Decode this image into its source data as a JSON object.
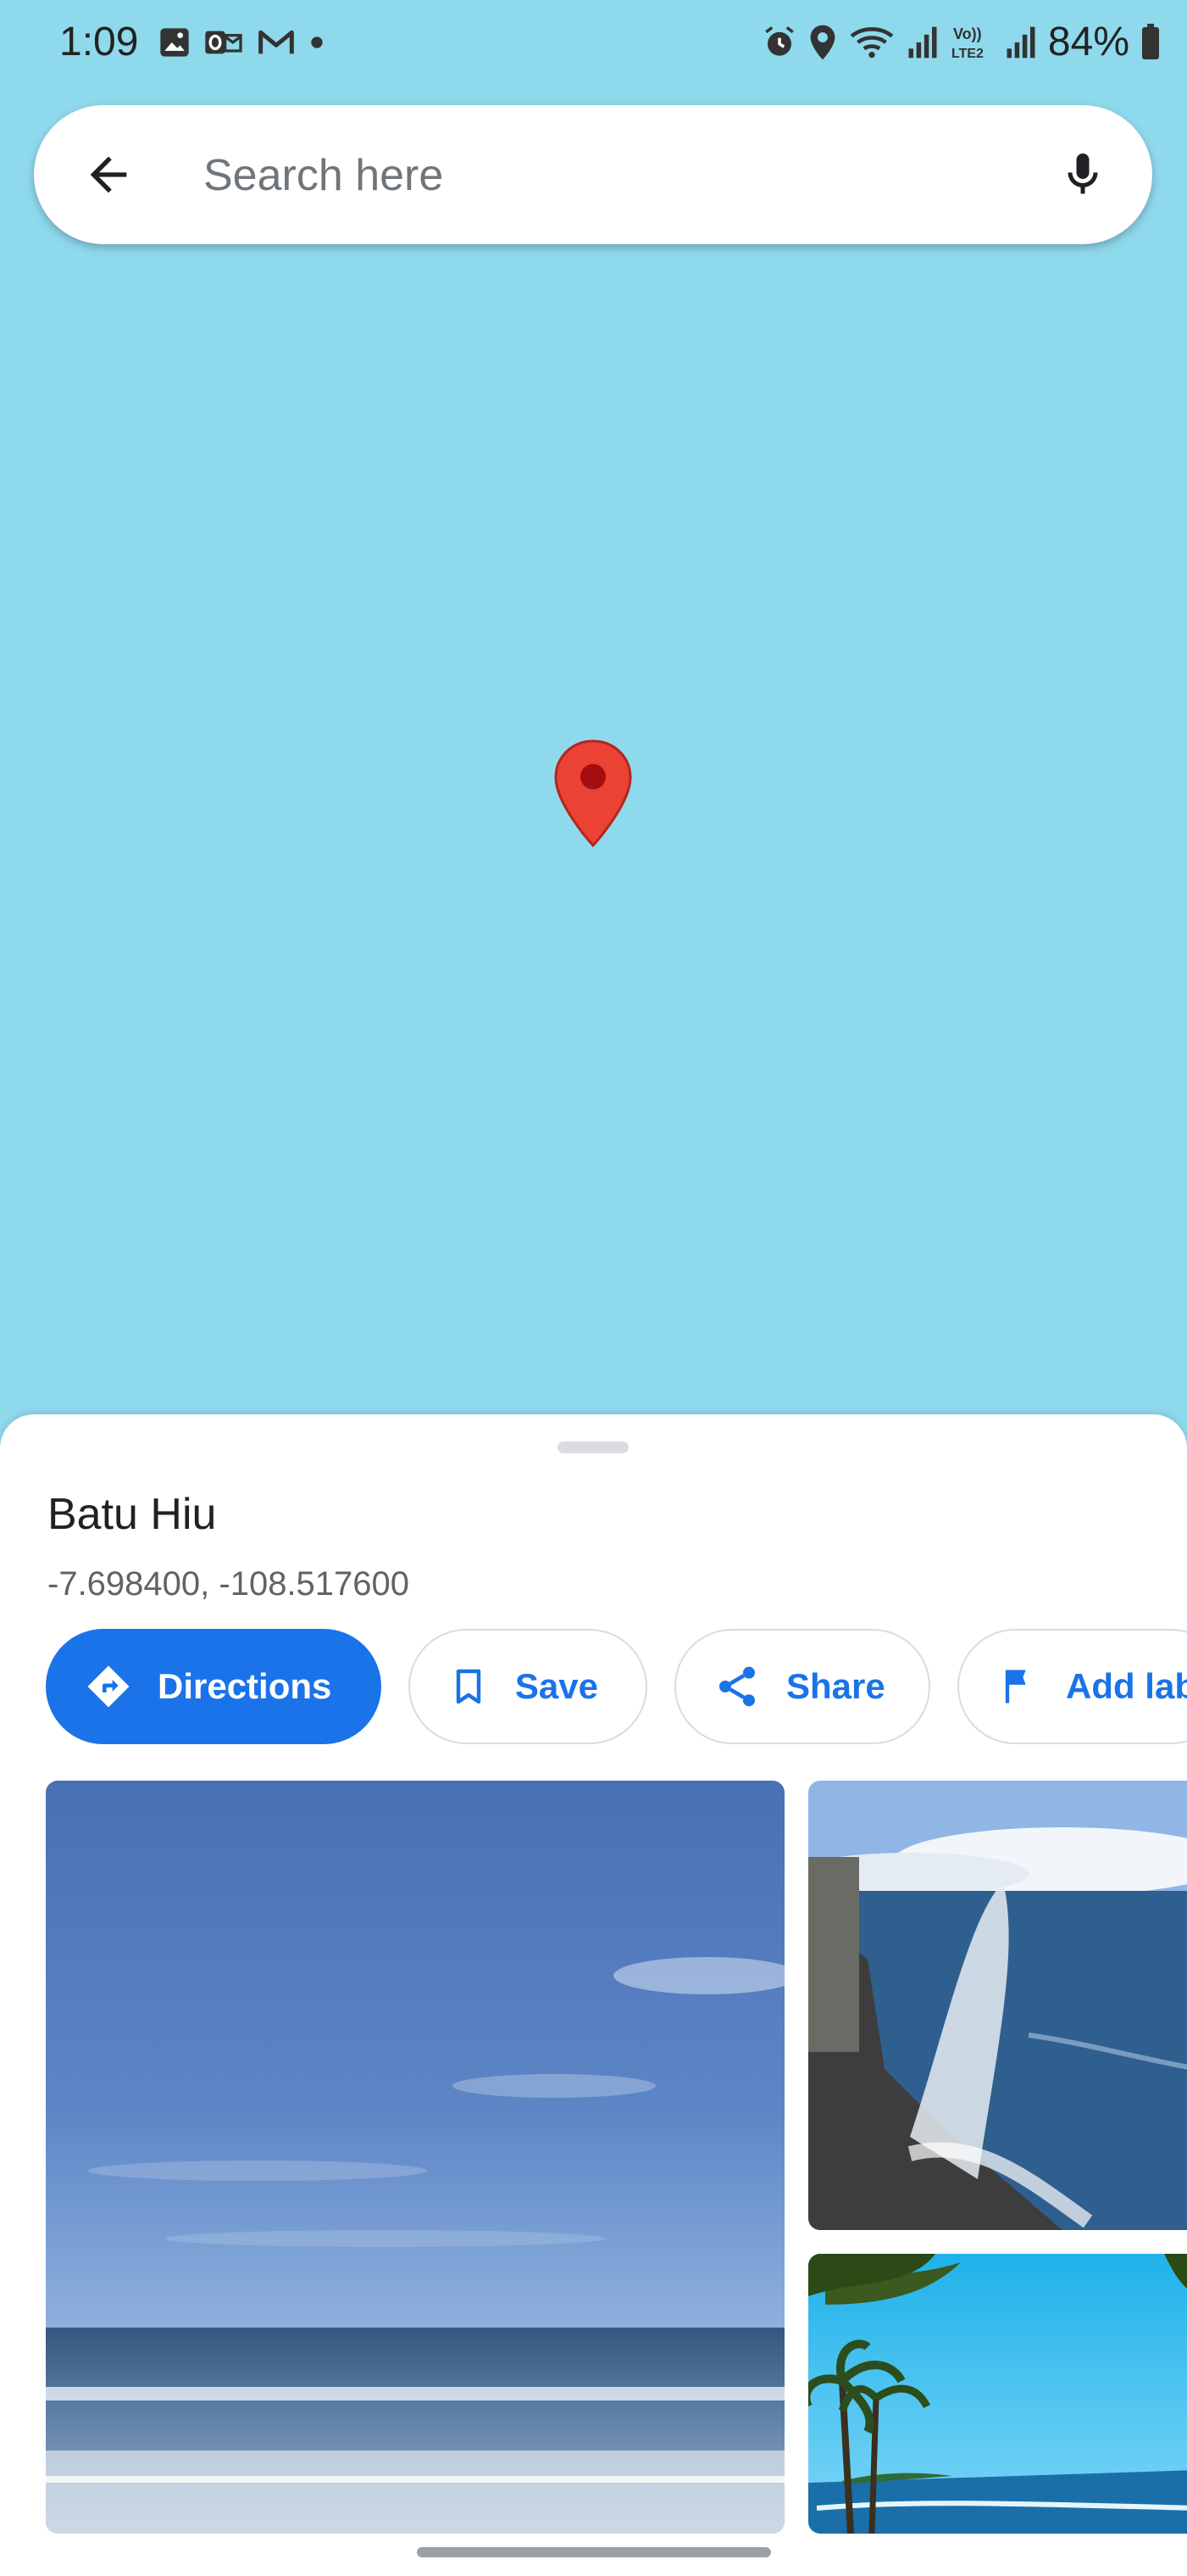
{
  "status_bar": {
    "time": "1:09",
    "battery": "84%",
    "left_icons": [
      "gallery-icon",
      "outlook-icon",
      "gmail-icon",
      "dot-icon"
    ],
    "right_icons": [
      "alarm-icon",
      "location-icon",
      "wifi-icon",
      "signal-icon",
      "volte-icon",
      "signal-icon",
      "battery-icon"
    ]
  },
  "search": {
    "placeholder": "Search here",
    "value": ""
  },
  "place": {
    "name": "Batu Hiu",
    "coordinates": "-7.698400, -108.517600"
  },
  "actions": {
    "directions": "Directions",
    "save": "Save",
    "share": "Share",
    "add_label": "Add lab"
  },
  "colors": {
    "map_water": "#8fd9ec",
    "accent": "#1a73e8",
    "pin": "#ea4335"
  }
}
